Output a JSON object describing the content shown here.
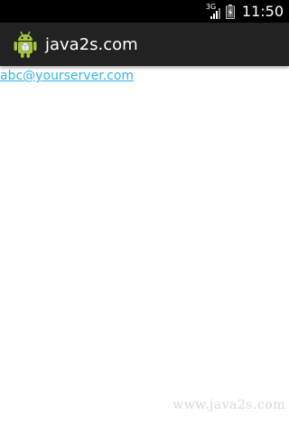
{
  "status_bar": {
    "network_label": "3G",
    "time": "11:50",
    "icons": [
      "signal-icon",
      "battery-icon"
    ]
  },
  "action_bar": {
    "app_icon": "android-icon",
    "title": "java2s.com"
  },
  "main": {
    "email_link": "abc@yourserver.com"
  },
  "watermark": "www.java2s.com",
  "colors": {
    "status_bar": "#000000",
    "action_bar": "#222222",
    "link": "#33b5e5",
    "android_green": "#a4c639"
  }
}
